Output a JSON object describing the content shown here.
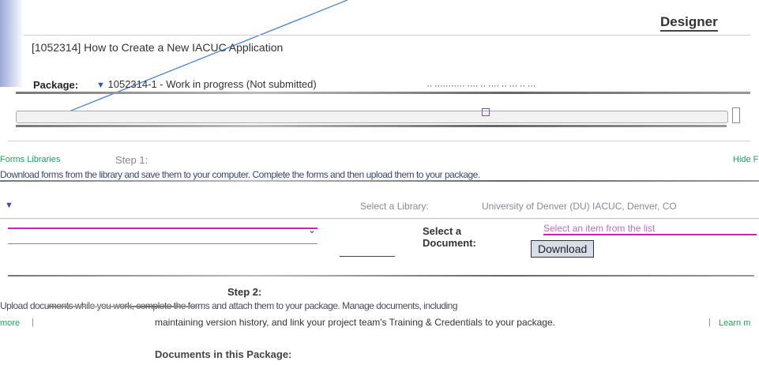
{
  "app": {
    "mode_label": "Designer"
  },
  "header": {
    "project_title": "[1052314] How to Create a New IACUC Application",
    "package_label": "Package:",
    "package_value": "1052314-1 - Work in progress (Not submitted)",
    "package_trailing": "·· ··········· ···· ·· ···· ·· ··· ·· ···"
  },
  "step1": {
    "left_link": "Forms Libraries",
    "title": "Step 1:",
    "right_link": "Hide F",
    "instruction_garbled": "Download forms from the library and save them to your computer. Complete the forms and then upload them to your package.",
    "select_library_label": "Select a Library:",
    "select_library_value": "University of Denver (DU) IACUC, Denver, CO",
    "select_document_label": "Select a\nDocument:",
    "select_document_value": "Select an item from the list",
    "download_button": "Download"
  },
  "step2": {
    "title": "Step 2:",
    "line1_garbled": "Upload documents while you work, complete the forms and attach them to your package. Manage documents, including",
    "line2_prefix_link": "more",
    "line2": "maintaining version history, and link your project team's Training & Credentials to your package.",
    "line2_link": "Learn m",
    "documents_heading": "Documents in this Package:"
  },
  "colors": {
    "link_green": "#1aa260",
    "link_blue": "#3366cc",
    "dropdown_arrow": "#3355bb",
    "magenta_line": "#d020c0",
    "button_face": "#d8dee8"
  }
}
